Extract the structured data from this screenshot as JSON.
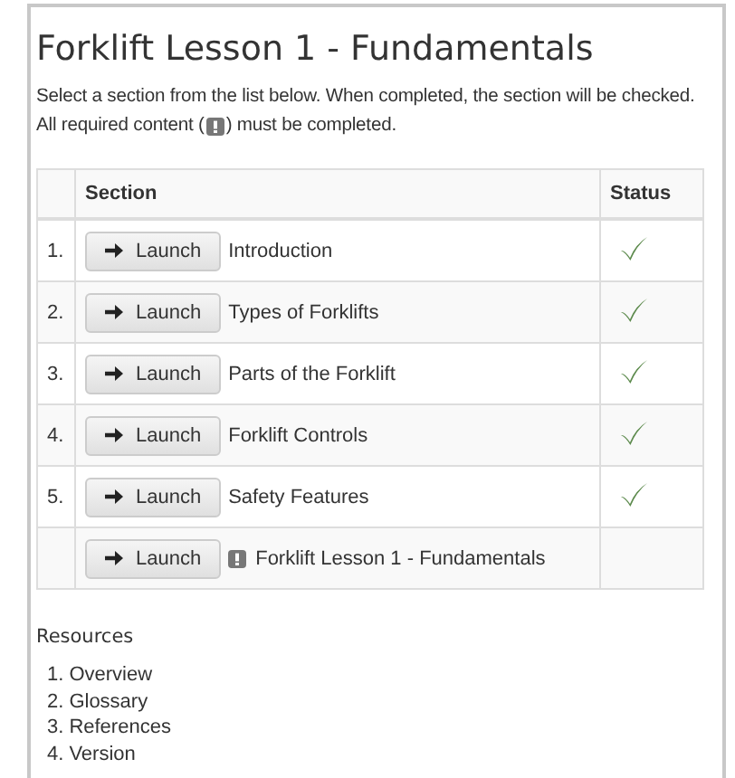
{
  "title": "Forklift Lesson 1 - Fundamentals",
  "intro": {
    "line_1": "Select a section from the list below. When completed, the section will be checked.",
    "line_2_before": "All required content (",
    "line_2_after": ") must be completed."
  },
  "table": {
    "columns": [
      "",
      "Section",
      "Status"
    ],
    "rows": [
      {
        "number": "1.",
        "button": "Launch",
        "title": "Introduction",
        "required": false,
        "completed": true
      },
      {
        "number": "2.",
        "button": "Launch",
        "title": "Types of Forklifts",
        "required": false,
        "completed": true
      },
      {
        "number": "3.",
        "button": "Launch",
        "title": "Parts of the Forklift",
        "required": false,
        "completed": true
      },
      {
        "number": "4.",
        "button": "Launch",
        "title": "Forklift Controls",
        "required": false,
        "completed": true
      },
      {
        "number": "5.",
        "button": "Launch",
        "title": "Safety Features",
        "required": false,
        "completed": true
      },
      {
        "button": "Launch",
        "title": "Forklift Lesson 1 - Fundamentals",
        "required": true,
        "completed": false
      }
    ]
  },
  "resources": {
    "heading": "Resources",
    "items": [
      {
        "number": "1.",
        "label": "Overview"
      },
      {
        "number": "2.",
        "label": "Glossary"
      },
      {
        "number": "3.",
        "label": "References"
      },
      {
        "number": "4.",
        "label": "Version"
      }
    ]
  }
}
